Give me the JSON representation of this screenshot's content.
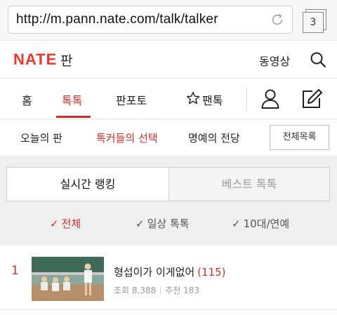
{
  "browser": {
    "url": "http://m.pann.nate.com/talk/talker",
    "tab_count": "3"
  },
  "header": {
    "logo": "NATE",
    "logo_sub": "판",
    "video_label": "동영상"
  },
  "nav": {
    "items": [
      {
        "label": "홈"
      },
      {
        "label": "톡톡"
      },
      {
        "label": "판포토"
      },
      {
        "label": "팬톡"
      }
    ],
    "active_index": 1
  },
  "subnav": {
    "items": [
      {
        "label": "오늘의 판"
      },
      {
        "label": "톡커들의 선택"
      },
      {
        "label": "명예의 전당"
      }
    ],
    "all_list_label": "전체목록"
  },
  "ranking": {
    "segments": [
      {
        "label": "실시간 랭킹"
      },
      {
        "label": "베스트 톡톡"
      }
    ],
    "filters": [
      {
        "label": "전체"
      },
      {
        "label": "일상 톡톡"
      },
      {
        "label": "10대/연예"
      }
    ]
  },
  "list": [
    {
      "rank": "1",
      "title": "형섭이가 이게없어",
      "comment_count": "(115)",
      "views": "조회 8,388",
      "likes": "추천 183"
    }
  ],
  "colors": {
    "accent": "#d22e27",
    "logo": "#e8392b"
  }
}
